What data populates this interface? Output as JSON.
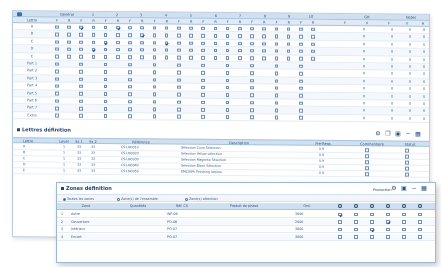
{
  "top_grid": {
    "header_row1": [
      "Général",
      "1",
      "2",
      "3",
      "4",
      "5",
      "6",
      "7",
      "8",
      "9",
      "10",
      "Gtt",
      "Notes"
    ],
    "header_row2": [
      "F",
      "R",
      "F",
      "R",
      "F",
      "R",
      "F",
      "R",
      "F",
      "R",
      "F",
      "R",
      "F",
      "R",
      "F",
      "R",
      "F",
      "R",
      "F",
      "R",
      "F",
      "R",
      "F",
      "V",
      "F",
      "V",
      "H"
    ],
    "corner_label": "Lettre",
    "row_labels": [
      "A",
      "B",
      "C",
      "D",
      "E",
      "Part 1",
      "Part 2",
      "Part 3",
      "Part 4",
      "Part 5",
      "Part 6",
      "Part 7",
      "Extra"
    ]
  },
  "section2": {
    "title": "Lettres définition",
    "columns": [
      "Lettre",
      "Level",
      "Ss 1",
      "Ss 2",
      "Référence",
      "Description",
      "Pré-Reqs",
      "Commentaire",
      "Statut"
    ],
    "rows": [
      {
        "letter": "A",
        "ref": "CS-LN0010",
        "desc": "Sélection Cuve Sélection",
        "pre": "0.9"
      },
      {
        "letter": "B",
        "ref": "CS-LN0020",
        "desc": "Sélection Yellow sélection",
        "pre": "0.9"
      },
      {
        "letter": "C",
        "ref": "CS-LN0030",
        "desc": "Sélection Magenta Sélection",
        "pre": "0.9"
      },
      {
        "letter": "D",
        "ref": "CS-LN0040",
        "desc": "Sélection Black Sélection",
        "pre": "0.9"
      },
      {
        "letter": "E",
        "ref": "CS-LN0050",
        "desc": "EMCS/Ph Finishing lamine",
        "pre": "0.9"
      }
    ]
  },
  "front": {
    "title": "Zones définition",
    "radio_options": [
      "Toutes les zones",
      "Zone(s) de l'ensemble",
      "Zone(s) sélection"
    ],
    "production_label": "Production",
    "columns": [
      "",
      "Zone",
      "Quantités",
      "Réf. CS",
      "Produit de phase",
      "Ord."
    ],
    "rows": [
      {
        "n": "1",
        "zone": "Autre",
        "ref": "WP-06",
        "val": "3000"
      },
      {
        "n": "2",
        "zone": "Couverture",
        "ref": "PO-06",
        "val": "2000"
      },
      {
        "n": "3",
        "zone": "Intérieur",
        "ref": "PO-07",
        "val": "3000"
      },
      {
        "n": "4",
        "zone": "Encart",
        "ref": "PO-07",
        "val": "3000"
      }
    ]
  },
  "icons": [
    "grid-icon",
    "copy-icon",
    "save-icon",
    "settings-icon",
    "cancel-icon",
    "calendar-icon"
  ]
}
